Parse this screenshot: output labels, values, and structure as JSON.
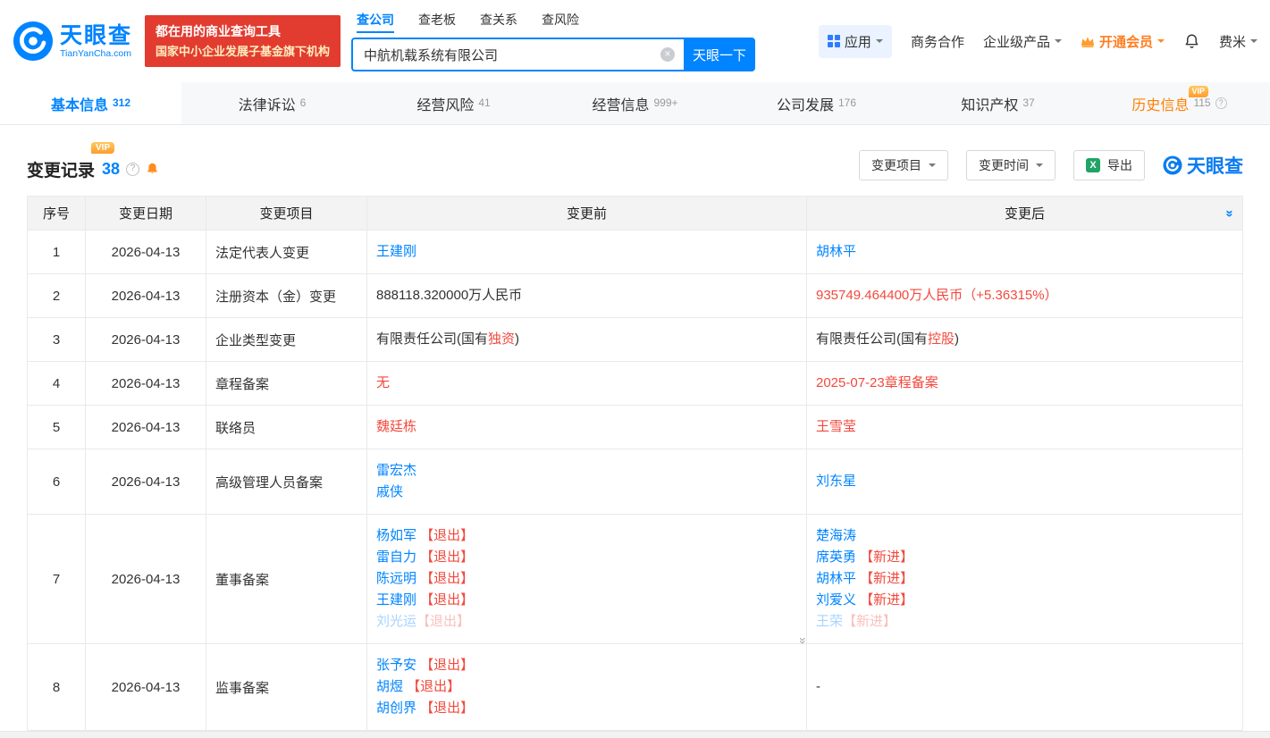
{
  "colors": {
    "brand_blue": "#0084ff",
    "alert_red": "#f2493d",
    "vip_orange": "#ff8000",
    "badge_red": "#e23c30",
    "excel_green": "#21a366"
  },
  "header": {
    "logo": {
      "cn": "天眼查",
      "en": "TianYanCha.com"
    },
    "slogan": {
      "line1": "都在用的商业查询工具",
      "line2": "国家中小企业发展子基金旗下机构"
    },
    "search": {
      "tabs": [
        "查公司",
        "查老板",
        "查关系",
        "查风险"
      ],
      "value": "中航机载系统有限公司",
      "button": "天眼一下"
    },
    "nav": {
      "apps": "应用",
      "business": "商务合作",
      "enterprise": "企业级产品",
      "vip": "开通会员",
      "user": "费米"
    }
  },
  "tabs": [
    {
      "key": "basic-info",
      "label": "基本信息",
      "count": "312",
      "active": true
    },
    {
      "key": "legal",
      "label": "法律诉讼",
      "count": "6"
    },
    {
      "key": "risk",
      "label": "经营风险",
      "count": "41"
    },
    {
      "key": "operation",
      "label": "经营信息",
      "count": "999+"
    },
    {
      "key": "development",
      "label": "公司发展",
      "count": "176"
    },
    {
      "key": "ip",
      "label": "知识产权",
      "count": "37"
    },
    {
      "key": "history",
      "label": "历史信息",
      "count": "115",
      "vip": true
    }
  ],
  "section": {
    "title": "变更记录",
    "count": "38",
    "vip_badge": "VIP",
    "filters": [
      {
        "label": "变更项目"
      },
      {
        "label": "变更时间"
      }
    ],
    "export": "导出",
    "watermark": "天眼查"
  },
  "table": {
    "columns": [
      "序号",
      "变更日期",
      "变更项目",
      "变更前",
      "变更后"
    ],
    "rows": [
      {
        "no": "1",
        "date": "2026-04-13",
        "item": "法定代表人变更",
        "before": [
          {
            "segs": [
              {
                "t": "王建刚",
                "s": "link"
              }
            ]
          }
        ],
        "after": [
          {
            "segs": [
              {
                "t": "胡林平",
                "s": "link"
              }
            ]
          }
        ]
      },
      {
        "no": "2",
        "date": "2026-04-13",
        "item": "注册资本（金）变更",
        "before": [
          {
            "segs": [
              {
                "t": "888118.320000万人民币",
                "s": "plain"
              }
            ]
          }
        ],
        "after": [
          {
            "segs": [
              {
                "t": "935749.464400万人民币（+5.36315%）",
                "s": "red"
              }
            ]
          }
        ]
      },
      {
        "no": "3",
        "date": "2026-04-13",
        "item": "企业类型变更",
        "before": [
          {
            "segs": [
              {
                "t": "有限责任公司(国有",
                "s": "plain"
              },
              {
                "t": "独资",
                "s": "red"
              },
              {
                "t": ")",
                "s": "plain"
              }
            ]
          }
        ],
        "after": [
          {
            "segs": [
              {
                "t": "有限责任公司(国有",
                "s": "plain"
              },
              {
                "t": "控股",
                "s": "red"
              },
              {
                "t": ")",
                "s": "plain"
              }
            ]
          }
        ]
      },
      {
        "no": "4",
        "date": "2026-04-13",
        "item": "章程备案",
        "before": [
          {
            "segs": [
              {
                "t": "无",
                "s": "red"
              }
            ]
          }
        ],
        "after": [
          {
            "segs": [
              {
                "t": "2025-07-23章程备案",
                "s": "red"
              }
            ]
          }
        ]
      },
      {
        "no": "5",
        "date": "2026-04-13",
        "item": "联络员",
        "before": [
          {
            "segs": [
              {
                "t": "魏廷栋",
                "s": "red"
              }
            ]
          }
        ],
        "after": [
          {
            "segs": [
              {
                "t": "王雪莹",
                "s": "red"
              }
            ]
          }
        ]
      },
      {
        "no": "6",
        "date": "2026-04-13",
        "item": "高级管理人员备案",
        "before": [
          {
            "segs": [
              {
                "t": "雷宏杰",
                "s": "link"
              }
            ]
          },
          {
            "segs": [
              {
                "t": "戚侠",
                "s": "link"
              }
            ]
          }
        ],
        "after": [
          {
            "segs": [
              {
                "t": "刘东星",
                "s": "link"
              }
            ]
          }
        ]
      },
      {
        "no": "7",
        "date": "2026-04-13",
        "item": "董事备案",
        "expandable": true,
        "before": [
          {
            "segs": [
              {
                "t": "杨如军",
                "s": "link"
              },
              {
                "t": " 【退出】",
                "s": "red"
              }
            ]
          },
          {
            "segs": [
              {
                "t": "雷自力",
                "s": "link"
              },
              {
                "t": " 【退出】",
                "s": "red"
              }
            ]
          },
          {
            "segs": [
              {
                "t": "陈远明",
                "s": "link"
              },
              {
                "t": " 【退出】",
                "s": "red"
              }
            ]
          },
          {
            "segs": [
              {
                "t": "王建刚",
                "s": "link"
              },
              {
                "t": " 【退出】",
                "s": "red"
              }
            ]
          },
          {
            "muted": true,
            "segs": [
              {
                "t": "刘光运",
                "s": "link"
              },
              {
                "t": "【退出】",
                "s": "red"
              }
            ]
          }
        ],
        "after": [
          {
            "segs": [
              {
                "t": "楚海涛",
                "s": "link"
              }
            ]
          },
          {
            "segs": [
              {
                "t": "席英勇",
                "s": "link"
              },
              {
                "t": " 【新进】",
                "s": "red"
              }
            ]
          },
          {
            "segs": [
              {
                "t": "胡林平",
                "s": "link"
              },
              {
                "t": " 【新进】",
                "s": "red"
              }
            ]
          },
          {
            "segs": [
              {
                "t": "刘爱义",
                "s": "link"
              },
              {
                "t": " 【新进】",
                "s": "red"
              }
            ]
          },
          {
            "muted": true,
            "segs": [
              {
                "t": "王荣",
                "s": "link"
              },
              {
                "t": "【新进】",
                "s": "red"
              }
            ]
          }
        ]
      },
      {
        "no": "8",
        "date": "2026-04-13",
        "item": "监事备案",
        "before": [
          {
            "segs": [
              {
                "t": "张予安",
                "s": "link"
              },
              {
                "t": " 【退出】",
                "s": "red"
              }
            ]
          },
          {
            "segs": [
              {
                "t": "胡煜",
                "s": "link"
              },
              {
                "t": " 【退出】",
                "s": "red"
              }
            ]
          },
          {
            "segs": [
              {
                "t": "胡创界",
                "s": "link"
              },
              {
                "t": " 【退出】",
                "s": "red"
              }
            ]
          }
        ],
        "after": [
          {
            "segs": [
              {
                "t": "-",
                "s": "plain"
              }
            ]
          }
        ]
      }
    ]
  }
}
